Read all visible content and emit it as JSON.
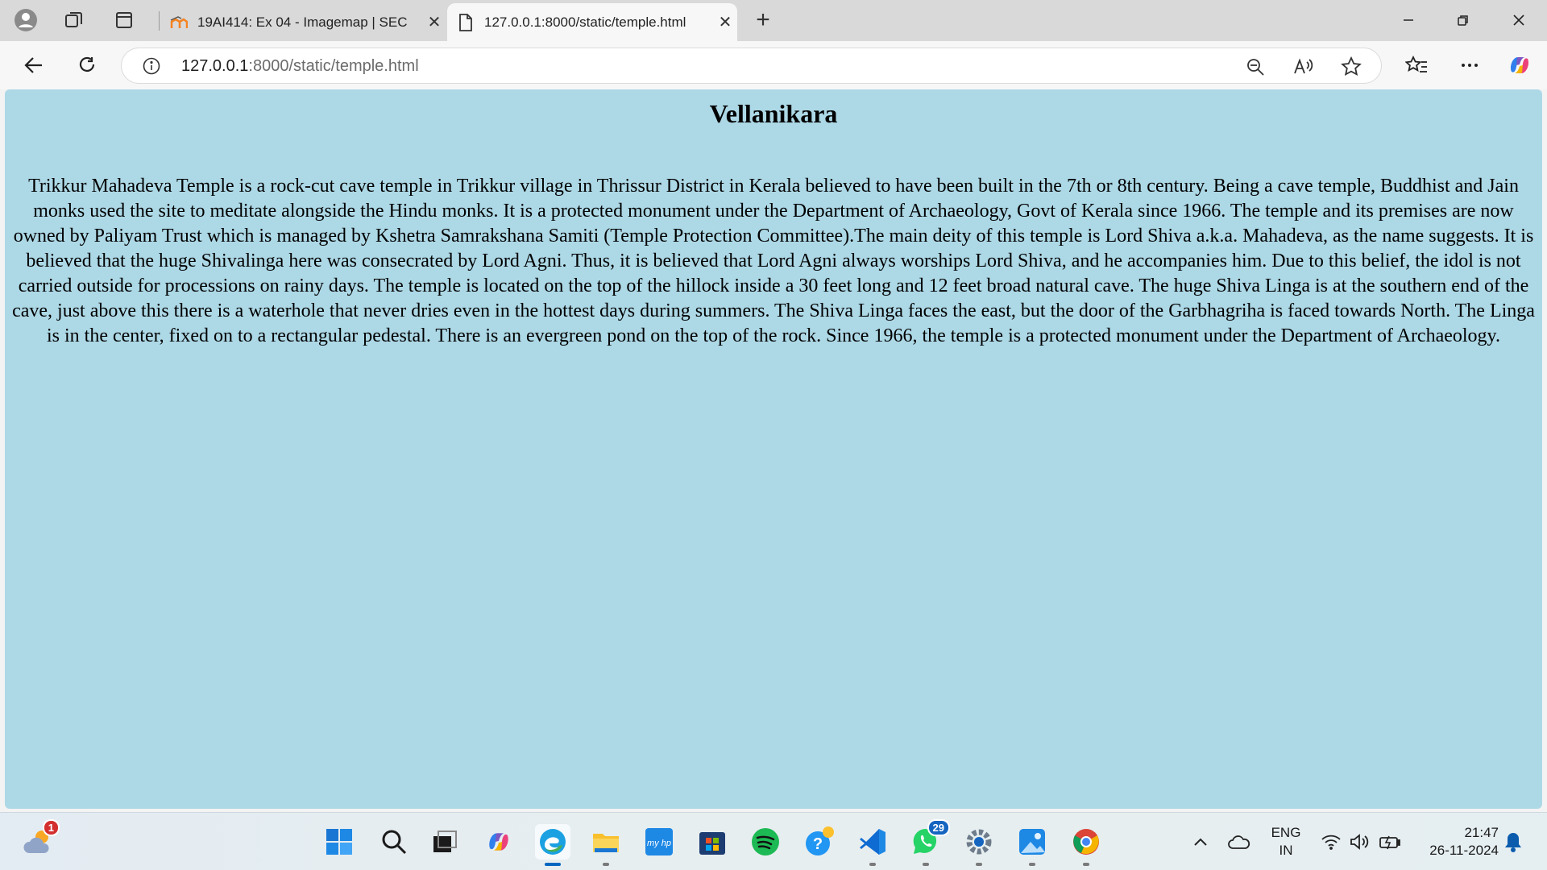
{
  "browser": {
    "tabs": [
      {
        "title": "19AI414: Ex 04 - Imagemap | SEC",
        "active": false
      },
      {
        "title": "127.0.0.1:8000/static/temple.html",
        "active": true
      }
    ],
    "url_host": "127.0.0.1",
    "url_path": ":8000/static/temple.html"
  },
  "page": {
    "background": "#add8e6",
    "heading": "Vellanikara",
    "paragraph": "Trikkur Mahadeva Temple is a rock-cut cave temple in Trikkur village in Thrissur District in Kerala believed to have been built in the 7th or 8th century. Being a cave temple, Buddhist and Jain monks used the site to meditate alongside the Hindu monks. It is a protected monument under the Department of Archaeology, Govt of Kerala since 1966. The temple and its premises are now owned by Paliyam Trust which is managed by Kshetra Samrakshana Samiti (Temple Protection Committee).The main deity of this temple is Lord Shiva a.k.a. Mahadeva, as the name suggests. It is believed that the huge Shivalinga here was consecrated by Lord Agni. Thus, it is believed that Lord Agni always worships Lord Shiva, and he accompanies him. Due to this belief, the idol is not carried outside for processions on rainy days. The temple is located on the top of the hillock inside a 30 feet long and 12 feet broad natural cave. The huge Shiva Linga is at the southern end of the cave, just above this there is a waterhole that never dries even in the hottest days during summers. The Shiva Linga faces the east, but the door of the Garbhagriha is faced towards North. The Linga is in the center, fixed on to a rectangular pedestal. There is an evergreen pond on the top of the rock. Since 1966, the temple is a protected monument under the Department of Archaeology."
  },
  "taskbar": {
    "weather_badge": "1",
    "whatsapp_badge": "29",
    "lang_line1": "ENG",
    "lang_line2": "IN",
    "time": "21:47",
    "date": "26-11-2024",
    "icons": [
      "weather-icon",
      "start-icon",
      "search-icon",
      "task-view-icon",
      "copilot-icon",
      "edge-icon",
      "file-explorer-icon",
      "myhp-icon",
      "microsoft-store-icon",
      "spotify-icon",
      "help-icon",
      "vscode-icon",
      "whatsapp-icon",
      "settings-icon",
      "photos-icon",
      "chrome-icon"
    ]
  }
}
